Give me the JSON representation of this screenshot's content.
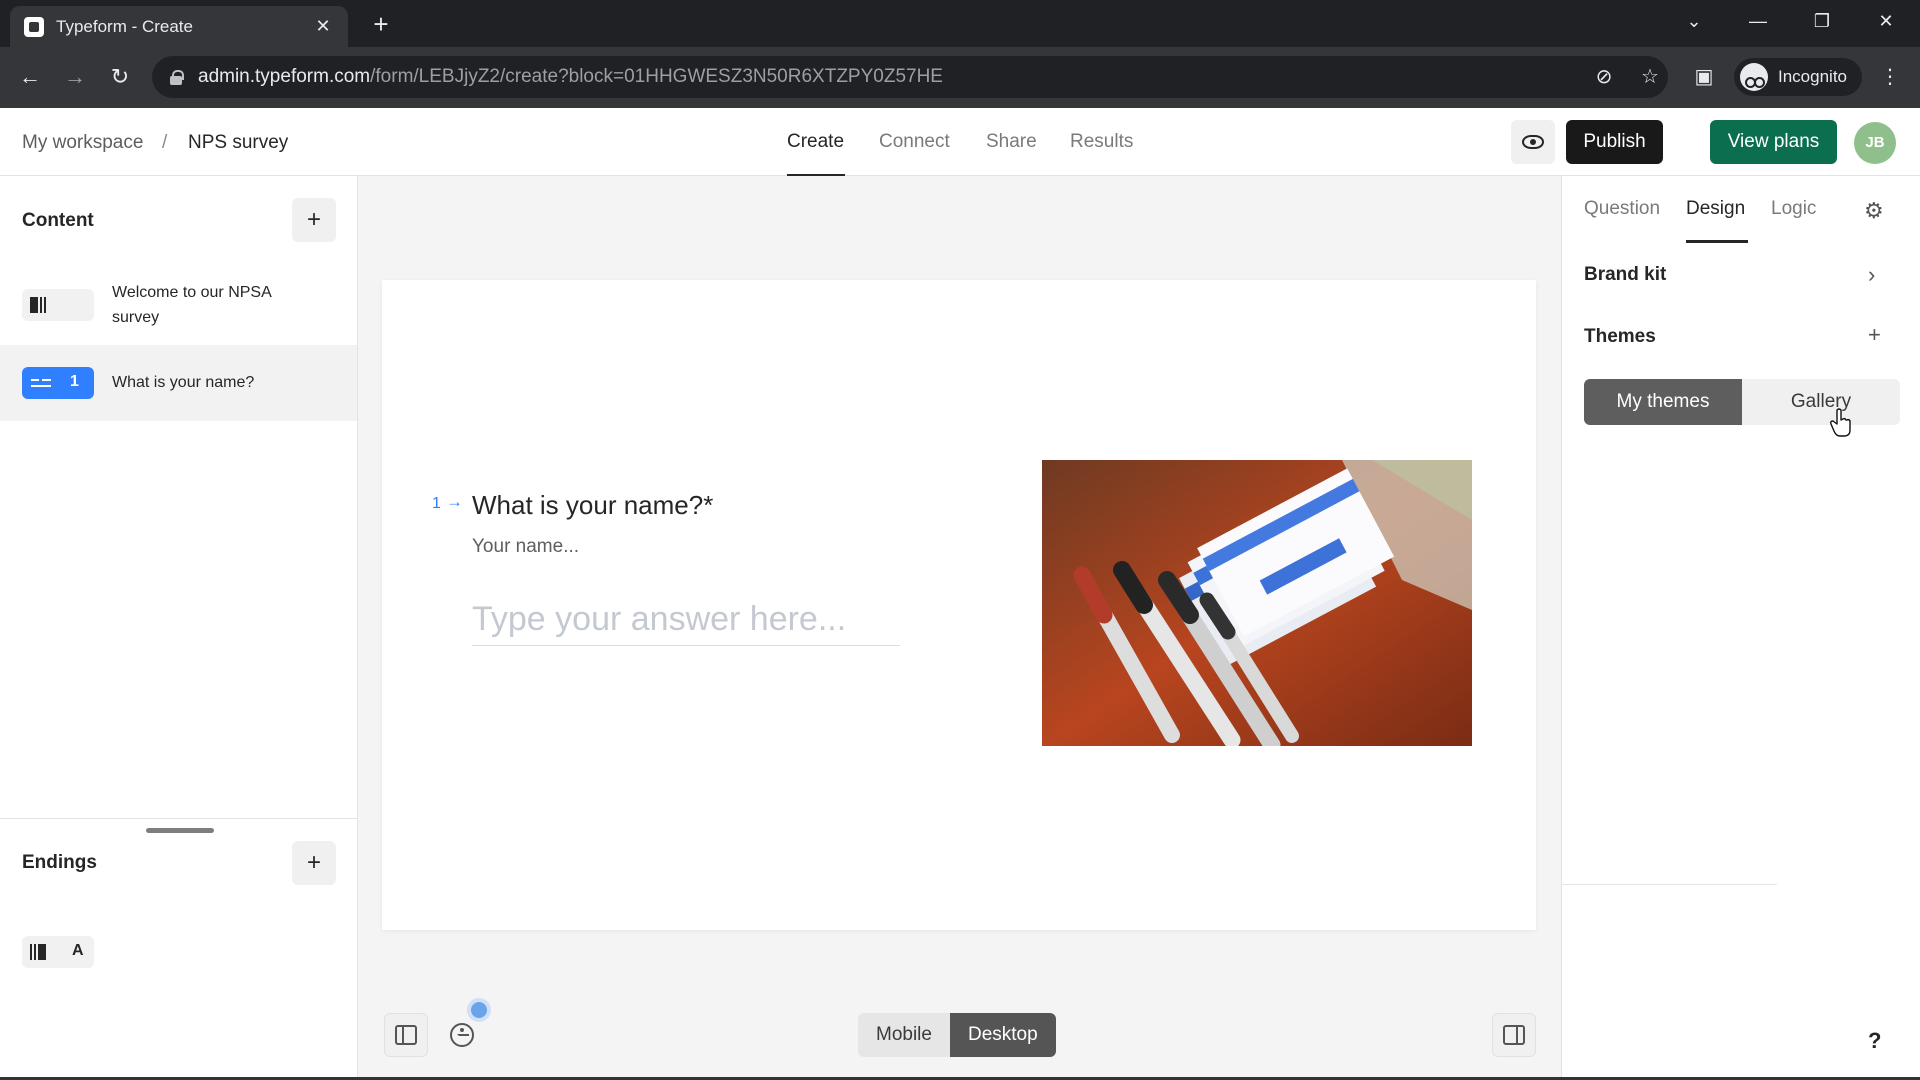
{
  "browser": {
    "tab_title": "Typeform - Create",
    "tab_close": "✕",
    "new_tab": "+",
    "url_host": "admin.typeform.com",
    "url_path": "/form/LEBJjyZ2/create?block=01HHGWESZ3N50R6XTZPY0Z57HE",
    "incognito_label": "Incognito"
  },
  "header": {
    "breadcrumb": [
      "My workspace",
      "NPS survey"
    ],
    "breadcrumb_sep": "/",
    "tabs": [
      "Create",
      "Connect",
      "Share",
      "Results"
    ],
    "active_tab": "Create",
    "publish_label": "Publish",
    "view_plans_label": "View plans",
    "avatar_initials": "JB"
  },
  "sidebar": {
    "content_title": "Content",
    "add_symbol": "+",
    "items": [
      {
        "label": "Welcome to our NPSA survey",
        "type": "welcome-screen"
      },
      {
        "label": "What is your name?",
        "type": "short-text",
        "number": "1"
      }
    ],
    "endings_title": "Endings",
    "endings": [
      {
        "letter": "A"
      }
    ]
  },
  "canvas": {
    "question_number": "1",
    "question_arrow": "→",
    "question_title": "What is your name?*",
    "question_description": "Your name...",
    "answer_placeholder": "Type your answer here...",
    "view_toggle": [
      "Mobile",
      "Desktop"
    ],
    "active_view": "Desktop"
  },
  "right_panel": {
    "tabs": [
      "Question",
      "Design",
      "Logic"
    ],
    "active_tab": "Design",
    "brand_kit_label": "Brand kit",
    "themes_label": "Themes",
    "themes_toggle": [
      "My themes",
      "Gallery"
    ],
    "active_theme_tab": "My themes",
    "help_label": "?"
  },
  "colors": {
    "accent_blue": "#2f7fff",
    "publish_bg": "#191919",
    "view_plans_bg": "#0b6e4f",
    "avatar_bg": "#8fbf8a"
  }
}
